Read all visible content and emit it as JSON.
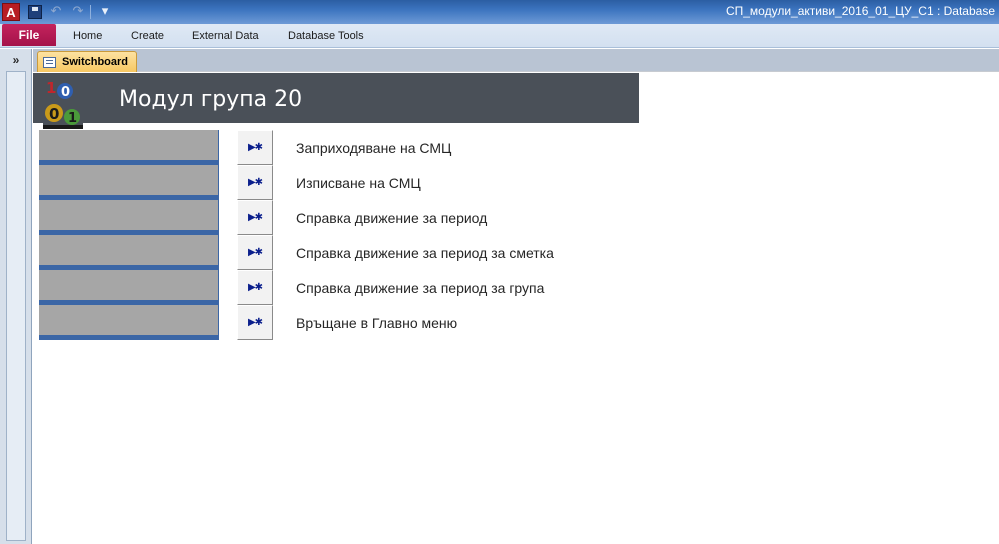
{
  "window": {
    "title": "СП_модули_активи_2016_01_ЦУ_С1 : Database"
  },
  "quick_access": {
    "app_icon": "A"
  },
  "ribbon": {
    "file_label": "File",
    "tabs": [
      {
        "label": "Home"
      },
      {
        "label": "Create"
      },
      {
        "label": "External Data"
      },
      {
        "label": "Database Tools"
      }
    ]
  },
  "navigation": {
    "toggle_label": "»"
  },
  "document": {
    "tab_label": "Switchboard"
  },
  "switchboard": {
    "title": "Модул група 20",
    "items": [
      {
        "label": "Заприходяване на СМЦ"
      },
      {
        "label": "Изписване на СМЦ"
      },
      {
        "label": "Справка движение за период"
      },
      {
        "label": "Справка движение за период за сметка"
      },
      {
        "label": "Справка движение за период за група"
      },
      {
        "label": "Връщане в Главно меню"
      }
    ]
  },
  "colors": {
    "header_bg": "#4a5058",
    "side_panel": "#3b66a6",
    "side_bars": "#a6a6a6",
    "file_tab": "#b5184f",
    "doc_tab": "#f7c862"
  }
}
